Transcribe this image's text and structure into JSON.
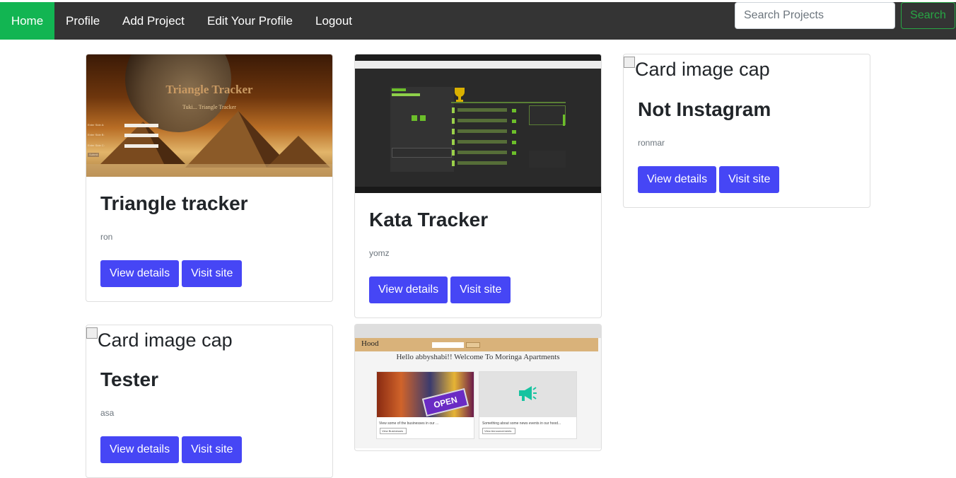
{
  "navbar": {
    "items": [
      {
        "label": "Home"
      },
      {
        "label": "Profile"
      },
      {
        "label": "Add Project"
      },
      {
        "label": "Edit Your Profile"
      },
      {
        "label": "Logout"
      }
    ],
    "search": {
      "placeholder": "Search Projects",
      "value": ""
    },
    "search_button_label": "Search"
  },
  "projects": [
    {
      "title": "Triangle tracker",
      "author": "ron",
      "details_label": "View details",
      "visit_label": "Visit site",
      "screenshot": {
        "heading": "Triangle Tracker",
        "subheading": "Tuki... Triangle Tracker",
        "fields": [
          "Enter Side A:",
          "Enter Side B:",
          "Enter Side C:"
        ],
        "button": "Submit"
      }
    },
    {
      "title": "Kata Tracker",
      "author": "yomz",
      "details_label": "View details",
      "visit_label": "Visit site"
    },
    {
      "title": "Not Instagram",
      "author": "ronmar",
      "image_alt": "Card image cap",
      "details_label": "View details",
      "visit_label": "Visit site"
    },
    {
      "title": "Tester",
      "author": "asa",
      "image_alt": "Card image cap",
      "details_label": "View details",
      "visit_label": "Visit site"
    },
    {
      "screenshot": {
        "brand": "Hood",
        "heading": "Hello abbyshabi!! Welcome To Moringa Apartments",
        "sign": "OPEN",
        "caption1": "View some of the businesses in our ...",
        "caption2": "Something about some news events in our hood...",
        "button1": "View Businesses",
        "button2": "View Announcements"
      }
    }
  ],
  "colors": {
    "navbar_bg": "#343434",
    "home_active": "#12b552",
    "primary_button": "#4646f5",
    "search_outline": "#28a745"
  }
}
